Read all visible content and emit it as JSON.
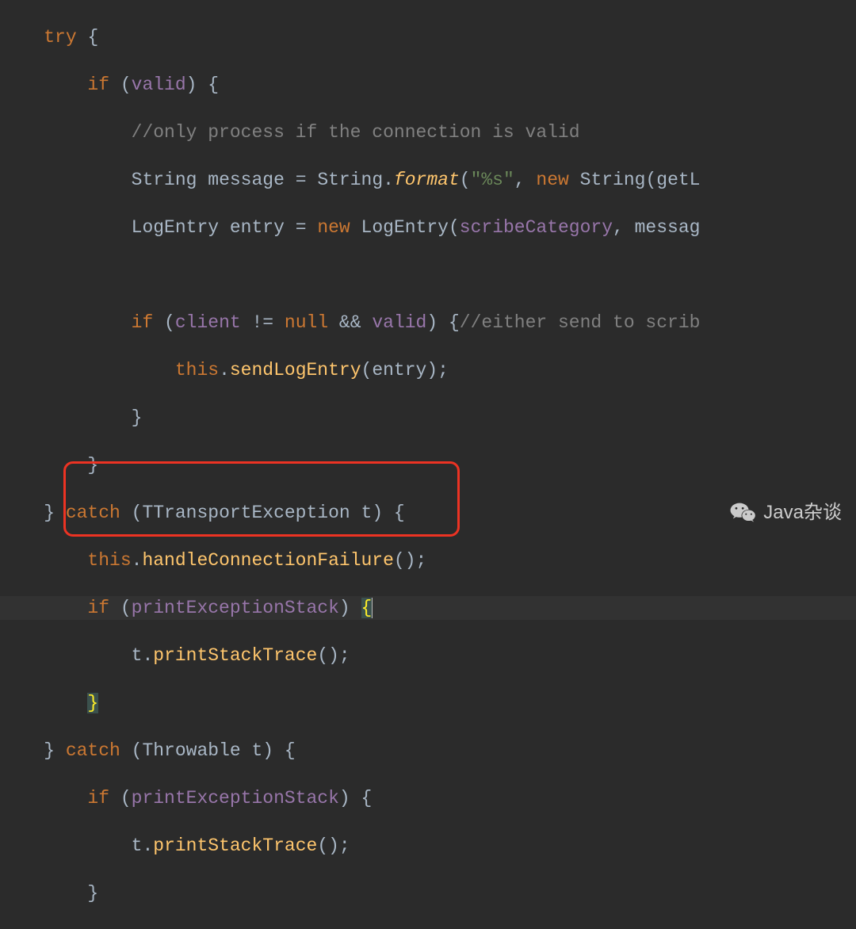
{
  "code": {
    "l1": {
      "indent": "    ",
      "kw": "try",
      "rest": " {"
    },
    "l2": {
      "indent": "        ",
      "kw": "if",
      "open": " (",
      "var": "valid",
      "close": ") {"
    },
    "l3": {
      "indent": "            ",
      "comment": "//only process if the connection is valid"
    },
    "l4": {
      "indent": "            ",
      "type1": "String ",
      "var1": "message",
      "eq": " = ",
      "type2": "String.",
      "method": "format",
      "args_open": "(",
      "str": "\"%s\"",
      "sep": ", ",
      "kw": "new",
      "sp": " ",
      "type3": "String(",
      "call": "getL"
    },
    "l5": {
      "indent": "            ",
      "type1": "LogEntry ",
      "var1": "entry",
      "eq": " = ",
      "kw": "new",
      "sp": " ",
      "type2": "LogEntry(",
      "arg1": "scribeCategory",
      "sep": ", ",
      "arg2": "messag"
    },
    "l6": {
      "indent": ""
    },
    "l7": {
      "indent": "            ",
      "kw1": "if",
      "open": " (",
      "var1": "client",
      "neq": " != ",
      "kw2": "null",
      "and": " && ",
      "var2": "valid",
      "close": ") {",
      "comment": "//either send to scrib"
    },
    "l8": {
      "indent": "                ",
      "kw": "this",
      "dot": ".",
      "method": "sendLogEntry",
      "args": "(entry);"
    },
    "l9": {
      "indent": "            ",
      "brace": "}"
    },
    "l10": {
      "indent": "        ",
      "brace": "}"
    },
    "l11": {
      "indent": "    ",
      "brace_close": "} ",
      "kw": "catch",
      "open": " (",
      "type": "TTransportException ",
      "var": "t",
      "close": ") {"
    },
    "l12": {
      "indent": "        ",
      "kw": "this",
      "dot": ".",
      "method": "handleConnectionFailure",
      "args": "();"
    },
    "l13": {
      "indent": "        ",
      "kw": "if",
      "open": " (",
      "var": "printExceptionStack",
      "close": ") ",
      "brace": "{"
    },
    "l14": {
      "indent": "            ",
      "var": "t",
      "dot": ".",
      "method": "printStackTrace",
      "args": "();"
    },
    "l15": {
      "indent": "        ",
      "brace": "}"
    },
    "l16": {
      "indent": "    ",
      "brace_close": "} ",
      "kw": "catch",
      "open": " (",
      "type": "Throwable ",
      "var": "t",
      "close": ") {"
    },
    "l17": {
      "indent": "        ",
      "kw": "if",
      "open": " (",
      "var": "printExceptionStack",
      "close": ") {"
    },
    "l18": {
      "indent": "            ",
      "var": "t",
      "dot": ".",
      "method": "printStackTrace",
      "args": "();"
    },
    "l19": {
      "indent": "        ",
      "brace": "}"
    }
  },
  "watermark": {
    "label": "Java杂谈"
  }
}
